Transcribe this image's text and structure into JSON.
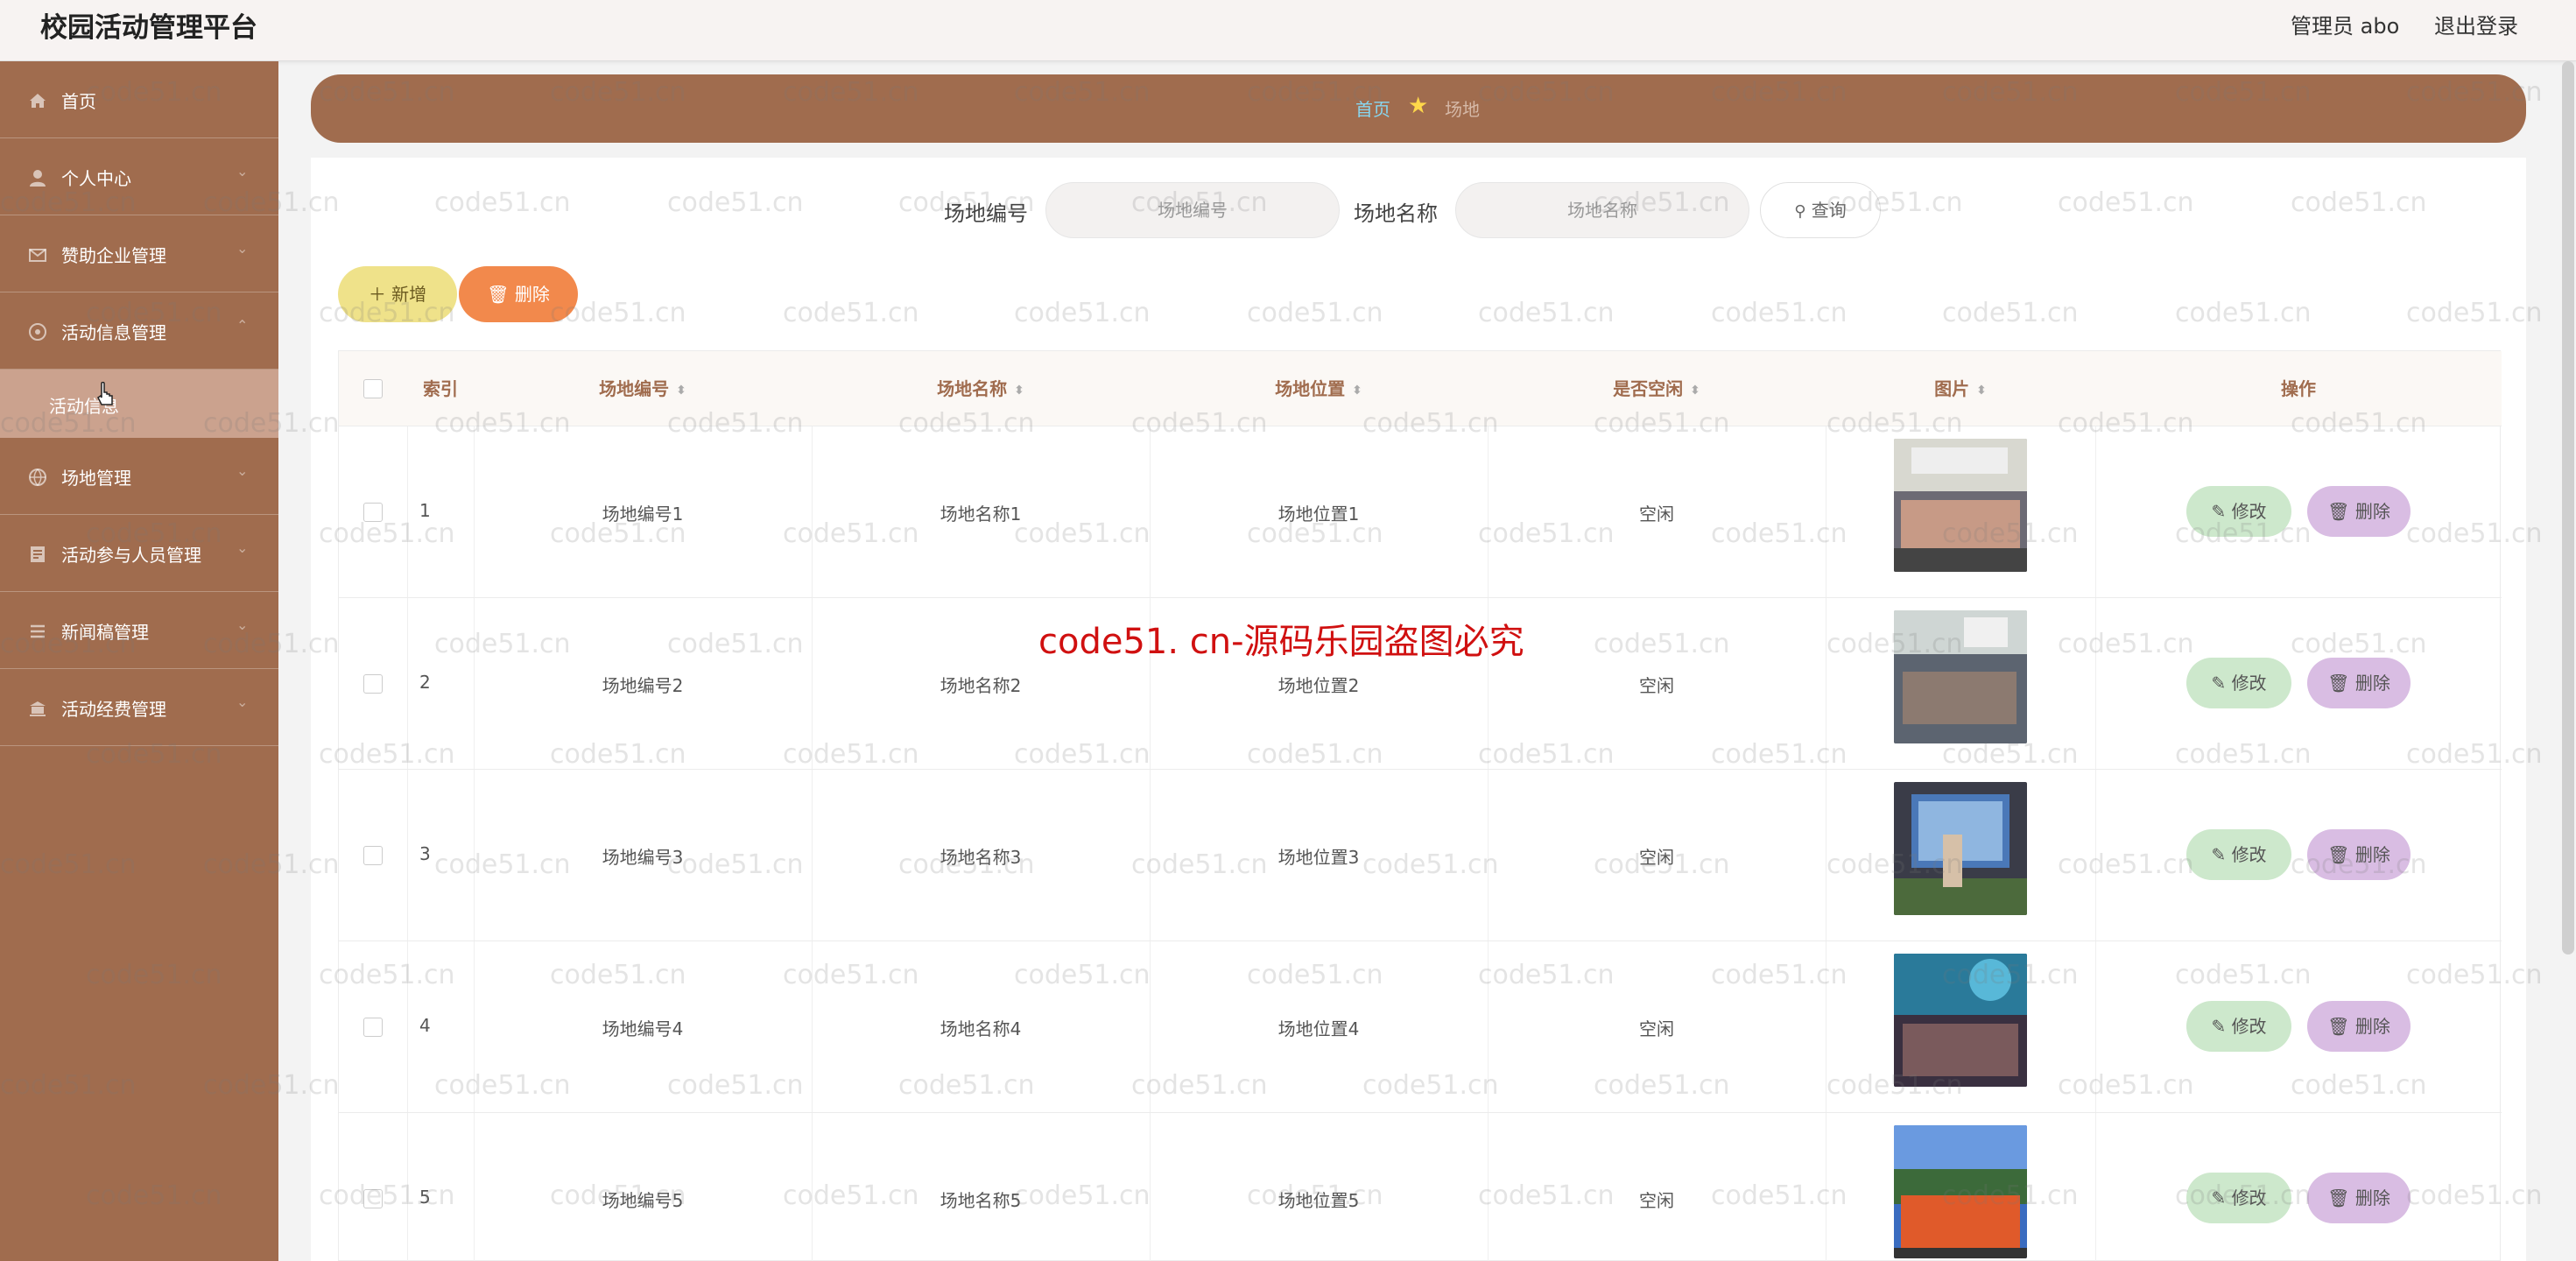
{
  "app": {
    "title": "校园活动管理平台"
  },
  "header": {
    "admin": "管理员 abo",
    "logout": "退出登录"
  },
  "sidebar": {
    "items": [
      {
        "label": "首页",
        "icon": "home-icon"
      },
      {
        "label": "个人中心",
        "icon": "user-icon"
      },
      {
        "label": "赞助企业管理",
        "icon": "mail-icon"
      },
      {
        "label": "活动信息管理",
        "icon": "compass-icon"
      },
      {
        "label": "场地管理",
        "icon": "globe-icon"
      },
      {
        "label": "活动参与人员管理",
        "icon": "document-icon"
      },
      {
        "label": "新闻稿管理",
        "icon": "list-icon"
      },
      {
        "label": "活动经费管理",
        "icon": "bank-icon"
      }
    ],
    "active_sub": {
      "label": "活动信息"
    }
  },
  "breadcrumb": {
    "home": "首页",
    "current": "场地"
  },
  "search": {
    "field1_label": "场地编号",
    "field1_placeholder": "场地编号",
    "field2_label": "场地名称",
    "field2_placeholder": "场地名称",
    "button": "查询"
  },
  "toolbar": {
    "add": "新增",
    "delete": "删除"
  },
  "table": {
    "headers": [
      "索引",
      "场地编号",
      "场地名称",
      "场地位置",
      "是否空闲",
      "图片",
      "操作"
    ],
    "rows": [
      {
        "index": "1",
        "code": "场地编号1",
        "name": "场地名称1",
        "location": "场地位置1",
        "free": "空闲"
      },
      {
        "index": "2",
        "code": "场地编号2",
        "name": "场地名称2",
        "location": "场地位置2",
        "free": "空闲"
      },
      {
        "index": "3",
        "code": "场地编号3",
        "name": "场地名称3",
        "location": "场地位置3",
        "free": "空闲"
      },
      {
        "index": "4",
        "code": "场地编号4",
        "name": "场地名称4",
        "location": "场地位置4",
        "free": "空闲"
      },
      {
        "index": "5",
        "code": "场地编号5",
        "name": "场地名称5",
        "location": "场地位置5",
        "free": "空闲"
      }
    ],
    "edit_label": "修改",
    "delete_label": "删除"
  },
  "watermark": {
    "text": "code51.cn",
    "center": "code51. cn-源码乐园盗图必究"
  },
  "colors": {
    "sidebar": "#a06c4e",
    "accent_blue": "#88d7f0",
    "add_btn": "#efe28a",
    "del_btn": "#f2894c",
    "edit_btn": "#cde8cc",
    "row_del_btn": "#d9bde3"
  }
}
